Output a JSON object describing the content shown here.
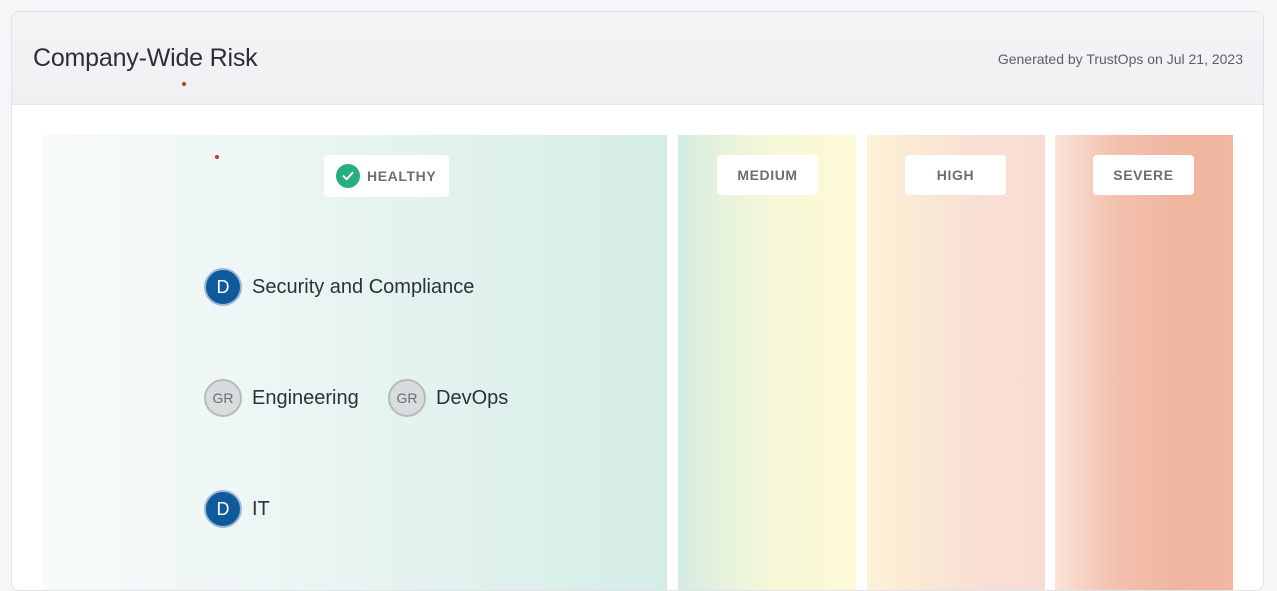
{
  "header": {
    "title": "Company-Wide Risk",
    "generated": "Generated by TrustOps on Jul 21, 2023"
  },
  "columns": {
    "healthy": {
      "label": "HEALTHY"
    },
    "medium": {
      "label": "MEDIUM"
    },
    "high": {
      "label": "HIGH"
    },
    "severe": {
      "label": "SEVERE"
    }
  },
  "items": [
    {
      "initials": "D",
      "label": "Security and Compliance"
    },
    {
      "initials": "GR",
      "label": "Engineering"
    },
    {
      "initials": "GR",
      "label": "DevOps"
    },
    {
      "initials": "D",
      "label": "IT"
    }
  ],
  "colors": {
    "healthy_check": "#27ae7f",
    "avatar_d": "#0f5a9b",
    "avatar_gr": "#d9dcdc"
  }
}
